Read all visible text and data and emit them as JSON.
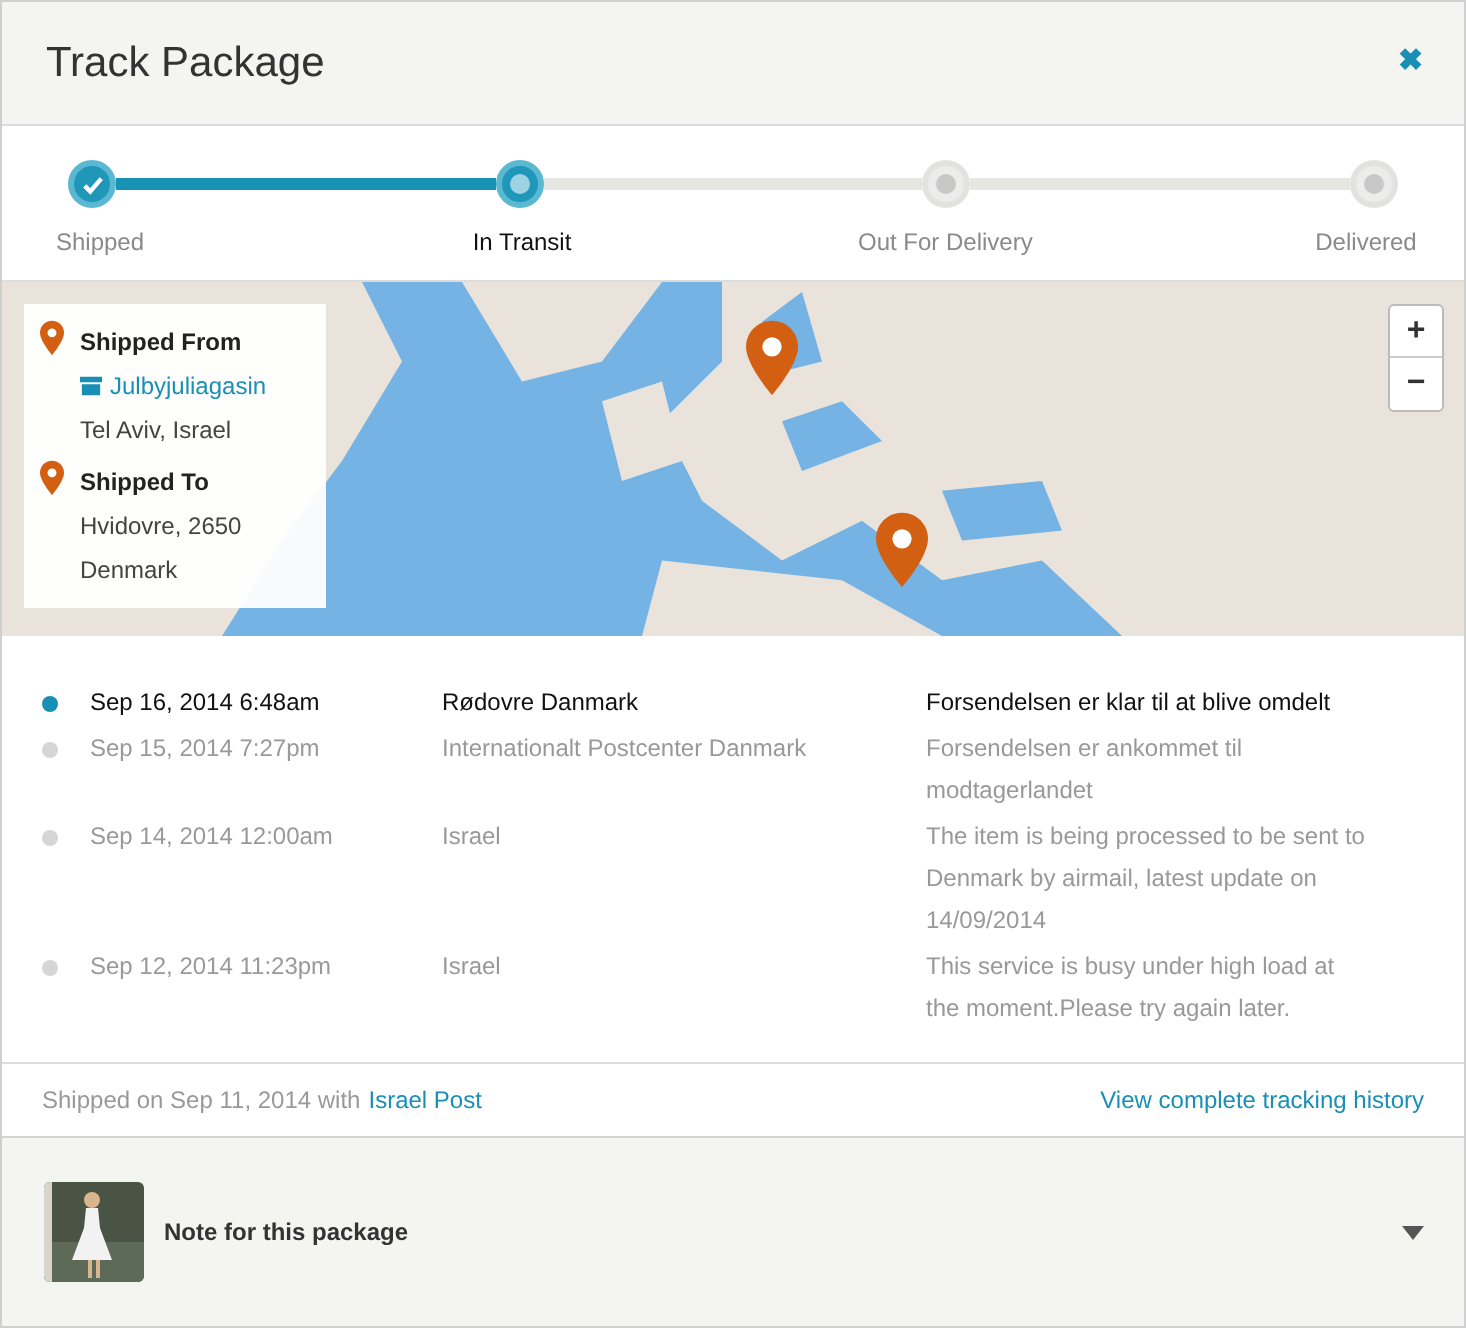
{
  "window": {
    "title": "Track Package",
    "close": "✖"
  },
  "steps": [
    {
      "label": "Shipped",
      "kind": "done"
    },
    {
      "label": "In Transit",
      "kind": "current"
    },
    {
      "label": "Out For Delivery",
      "kind": "pending"
    },
    {
      "label": "Delivered",
      "kind": "pending"
    }
  ],
  "map": {
    "zoom_in": "+",
    "zoom_out": "−",
    "origin": {
      "heading": "Shipped From",
      "store": "Julbyjuliagasin",
      "lines": [
        "Tel Aviv, Israel"
      ]
    },
    "destination": {
      "heading": "Shipped To",
      "lines": [
        "Hvidovre, 2650",
        "Denmark"
      ]
    }
  },
  "events": [
    {
      "date": "Sep 16, 2014 6:48am",
      "location": "Rødovre Danmark",
      "description": "Forsendelsen er klar til at blive omdelt",
      "latest": true
    },
    {
      "date": "Sep 15, 2014 7:27pm",
      "location": "Internationalt Postcenter Danmark",
      "description": "Forsendelsen er ankommet til modtagerlandet",
      "latest": false
    },
    {
      "date": "Sep 14, 2014 12:00am",
      "location": "Israel",
      "description": "The item is being processed to be sent to Denmark by airmail, latest update on 14/09/2014",
      "latest": false
    },
    {
      "date": "Sep 12, 2014 11:23pm",
      "location": "Israel",
      "description": "This service is busy under high load at the moment.Please try again later.",
      "latest": false
    }
  ],
  "footer": {
    "shipped_text": "Shipped on Sep 11, 2014 with",
    "carrier": "Israel Post",
    "history_link": "View complete tracking history"
  },
  "note": {
    "label": "Note for this package",
    "expanded": false
  }
}
